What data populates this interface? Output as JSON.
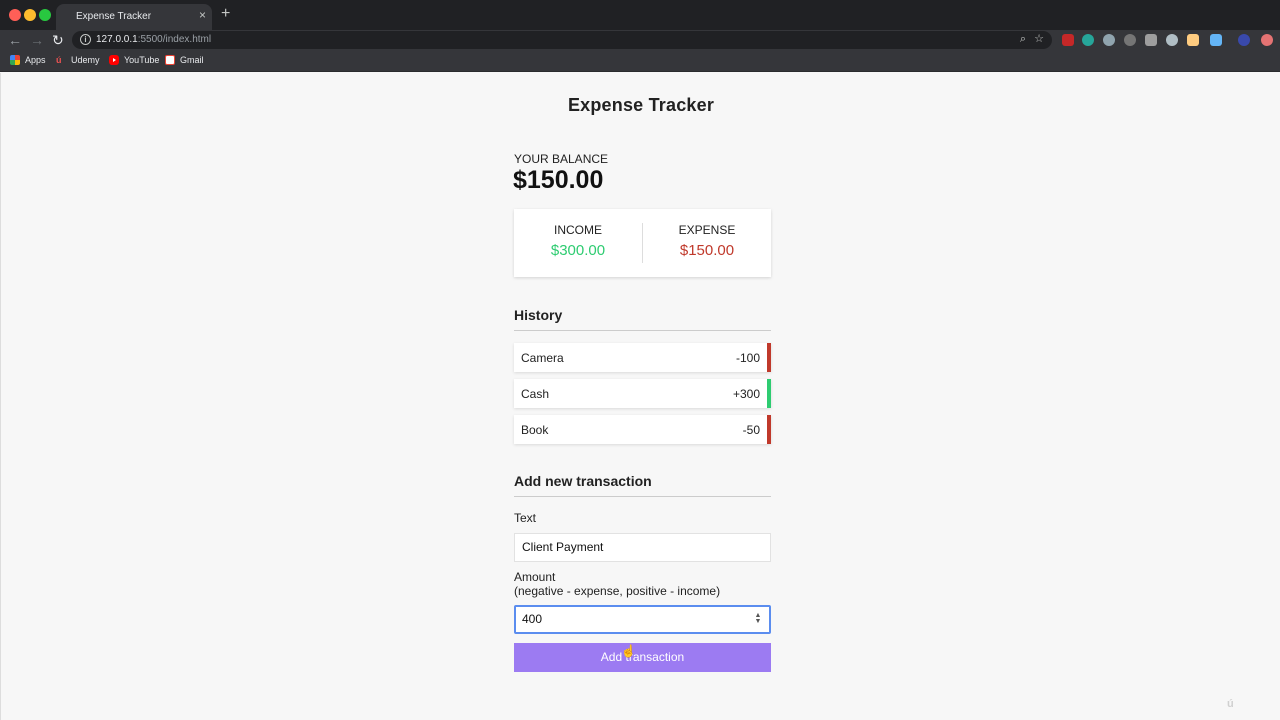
{
  "browser": {
    "tab_title": "Expense Tracker",
    "tab_close": "×",
    "new_tab": "+",
    "url_host": "127.0.0.1",
    "url_rest": ":5500/index.html",
    "bookmarks": [
      "Apps",
      "Udemy",
      "YouTube",
      "Gmail"
    ]
  },
  "app": {
    "title": "Expense Tracker",
    "balance_label": "YOUR BALANCE",
    "balance_value": "$150.00",
    "income_label": "INCOME",
    "income_value": "$300.00",
    "expense_label": "EXPENSE",
    "expense_value": "$150.00",
    "history_title": "History",
    "transactions": [
      {
        "text": "Camera",
        "amount": "-100",
        "type": "minus"
      },
      {
        "text": "Cash",
        "amount": "+300",
        "type": "plus"
      },
      {
        "text": "Book",
        "amount": "-50",
        "type": "minus"
      }
    ],
    "form": {
      "title": "Add new transaction",
      "text_label": "Text",
      "text_value": "Client Payment",
      "amount_label": "Amount",
      "amount_hint": "(negative - expense, positive - income)",
      "amount_value": "400",
      "submit_label": "Add transaction"
    }
  },
  "colors": {
    "income": "#2ecc71",
    "expense": "#c0392b",
    "button": "#9c7bf2",
    "focus": "#5b8def"
  }
}
